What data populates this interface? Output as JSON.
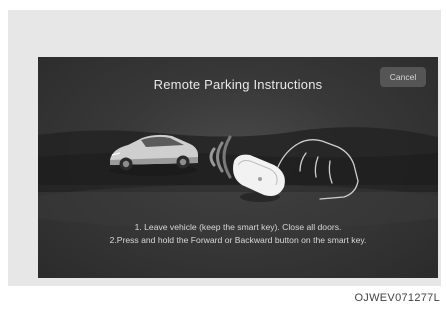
{
  "screen": {
    "title": "Remote Parking Instructions",
    "cancel_label": "Cancel",
    "instructions": [
      "1. Leave vehicle (keep the smart key). Close all doors.",
      "2.Press and hold the Forward or Backward button on the smart key."
    ]
  },
  "figure_code": "OJWEV071277L",
  "icons": [
    "car-icon",
    "wireless-signal-icon",
    "smart-key-icon",
    "hand-icon"
  ]
}
